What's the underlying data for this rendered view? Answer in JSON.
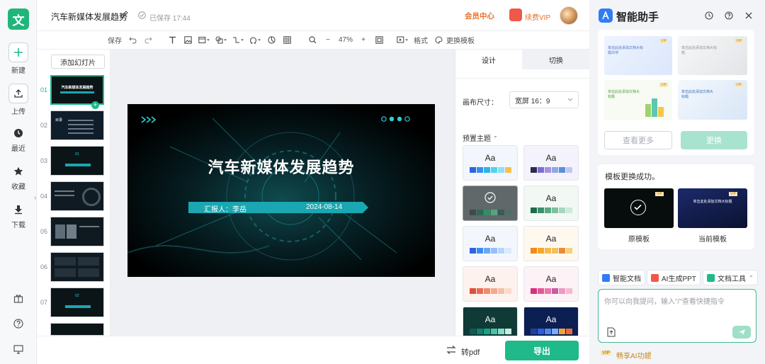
{
  "app": {
    "logo_char": "文",
    "accent": "#1fb98a"
  },
  "rail": {
    "items": [
      {
        "key": "new",
        "label": "新建"
      },
      {
        "key": "upload",
        "label": "上传"
      },
      {
        "key": "recent",
        "label": "最近"
      },
      {
        "key": "favorite",
        "label": "收藏"
      },
      {
        "key": "download",
        "label": "下载"
      }
    ]
  },
  "topbar": {
    "doc_title": "汽车新媒体发展趋势",
    "save_status": "已保存 17:44",
    "member_center": "会员中心",
    "vip_label": "续费VIP"
  },
  "toolbar": {
    "save": "保存",
    "zoom": "47%",
    "format": "格式",
    "replace_template": "更换模板"
  },
  "slides_panel": {
    "add_slide": "添加幻灯片",
    "numbers": [
      "01",
      "02",
      "03",
      "04",
      "05",
      "06",
      "07"
    ],
    "thumb_texts": [
      "汽车新媒体发展趋势",
      "目录",
      "01",
      "",
      "",
      "",
      "02"
    ],
    "selected": 0
  },
  "slide": {
    "title": "汽车新媒体发展趋势",
    "reporter": "汇报人：李岳",
    "date": "2024-08-14"
  },
  "right_panel": {
    "tabs": [
      "设计",
      "切换"
    ],
    "active_tab": 0,
    "canvas_size_label": "画布尺寸：",
    "canvas_size_value": "宽屏 16：9",
    "preset_theme_label": "预置主题",
    "theme_aa": "Aa",
    "themes": [
      {
        "bg": "#f3f7fd",
        "colors": [
          "#2a66d9",
          "#3b8cf0",
          "#27b7e8",
          "#55d0f0",
          "#8be1f4",
          "#f6c04c"
        ]
      },
      {
        "bg": "#f4f3fb",
        "colors": [
          "#2b2d4f",
          "#7c6bd6",
          "#a790e6",
          "#8fa7e6",
          "#5c8fd6",
          "#bfc9f0"
        ]
      },
      {
        "bg": "#606869",
        "colors": [
          "#3e4a4b",
          "#2d6b56",
          "#2e8f6a",
          "#54a57f",
          "#3c5a57",
          "#4f6e6a"
        ],
        "selected": true
      },
      {
        "bg": "#f2f8f4",
        "colors": [
          "#1f6a4d",
          "#3a8f6a",
          "#58a984",
          "#7cc09e",
          "#a6d6bd",
          "#cde8d9"
        ]
      },
      {
        "bg": "#f3f7fd",
        "colors": [
          "#2a66d9",
          "#3b8cf0",
          "#6aa7f4",
          "#94c0f7",
          "#b9d6f9",
          "#dbe9fc"
        ]
      },
      {
        "bg": "#fff8ee",
        "colors": [
          "#f08a1a",
          "#f5a623",
          "#f7b84e",
          "#f1c25f",
          "#e98c3a",
          "#f4d27c"
        ]
      },
      {
        "bg": "#fdf2ee",
        "colors": [
          "#e04f3c",
          "#ea6a56",
          "#f08a6d",
          "#f4a88e",
          "#f6c0aa",
          "#fbd9cc"
        ]
      },
      {
        "bg": "#fdf2f6",
        "colors": [
          "#d6317c",
          "#e35796",
          "#ea76ab",
          "#c95aa6",
          "#ef99c0",
          "#f5b9d4"
        ]
      },
      {
        "bg": "#0f3a35",
        "colors": [
          "#0d5c52",
          "#11806f",
          "#16a38b",
          "#4cc1a8",
          "#88dcc7",
          "#c4efe3"
        ]
      },
      {
        "bg": "#0c1f52",
        "colors": [
          "#1f3fa0",
          "#2d5fd6",
          "#4d86f0",
          "#7caaf5",
          "#f2a23b",
          "#e86a3a"
        ]
      }
    ]
  },
  "bottombar": {
    "to_pdf": "转pdf",
    "export": "导出"
  },
  "assistant": {
    "title": "智能助手",
    "more_button": "查看更多",
    "replace_button": "更换",
    "success_msg": "模板更换成功。",
    "original_label": "原模板",
    "current_label": "当前模板",
    "tpl_caption_1": "单击此处添加文档大标题20字",
    "tpl_caption_2": "单击此处添加文档大标题",
    "tpl_caption_3": "单击此处添加文档大标题",
    "tpl_caption_4": "单击此处添加文档大标题",
    "compare_caption": "单击此处添加文档大标题",
    "vip_tag": "VIP",
    "chips": [
      "智能文档",
      "AI生成PPT",
      "文档工具"
    ],
    "input_placeholder": "你可以向我提问，输入\"/\"查看快捷指令",
    "footer": "畅享AI功能"
  }
}
